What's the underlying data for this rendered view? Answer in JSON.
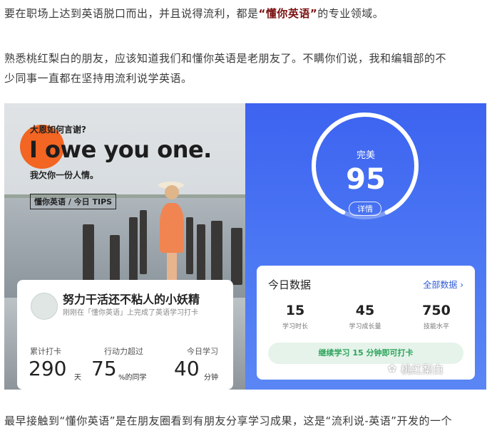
{
  "paragraphs": {
    "p1_pre": "要在职场上达到英语脱口而出，并且说得流利，都是",
    "p1_bold": "“懂你英语”",
    "p1_post": "的专业领域。",
    "p2_line1": "熟悉桃红梨白的朋友，应该知道我们和懂你英语是老朋友了。不瞒你们说，我和编辑部的不",
    "p2_line2": "少同事一直都在坚持用流利说学英语。",
    "p3": "最早接触到“懂你英语”是在朋友圈看到有朋友分享学习成果，这是“流利说-英语”开发的一个"
  },
  "left_card": {
    "question": "大恩如何言谢?",
    "phrase": "I owe you one.",
    "translation": "我欠你一份人情。",
    "tips": "懂你英语 / 今日 TIPS",
    "user_title": "努力干活还不粘人的小妖精",
    "user_sub": "刚刚在「懂你英语」上完成了英语学习打卡",
    "stats": [
      {
        "label": "累计打卡",
        "value": "290",
        "unit": "天"
      },
      {
        "label": "行动力超过",
        "value": "75",
        "unit": "%的同学"
      },
      {
        "label": "今日学习",
        "value": "40",
        "unit": "分钟"
      }
    ]
  },
  "right_card": {
    "ring_label": "完美",
    "score": "95",
    "detail_button": "详情",
    "ring_progress": 0.86,
    "data_title": "今日数据",
    "all_data_link": "全部数据 ›",
    "metrics": [
      {
        "value": "15",
        "label": "学习时长"
      },
      {
        "value": "45",
        "label": "学习成长量"
      },
      {
        "value": "750",
        "label": "技能水平"
      }
    ],
    "continue_button": "继续学习 15 分钟即可打卡"
  },
  "watermark": "桃红梨白",
  "colors": {
    "brand_dark_red": "#7a1010",
    "accent_orange": "#f26522",
    "panel_blue": "#3d63f0",
    "link_blue": "#2d5ad8",
    "green": "#2ba35a"
  }
}
